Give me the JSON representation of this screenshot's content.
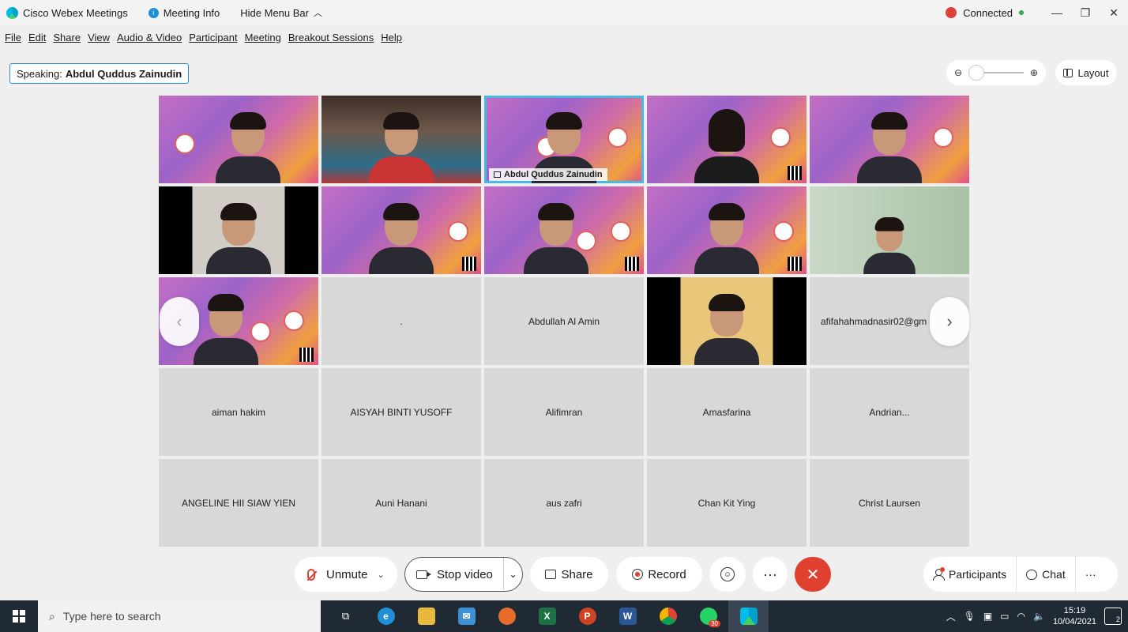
{
  "titlebar": {
    "app_name": "Cisco Webex Meetings",
    "meeting_info": "Meeting Info",
    "hide_menu": "Hide Menu Bar",
    "status": "Connected",
    "min": "—",
    "restore": "❐",
    "close": "✕"
  },
  "menu": [
    "File",
    "Edit",
    "Share",
    "View",
    "Audio & Video",
    "Participant",
    "Meeting",
    "Breakout Sessions",
    "Help"
  ],
  "speaking": {
    "prefix": "Speaking:",
    "name": "Abdul Quddus Zainudin"
  },
  "layout_label": "Layout",
  "active_speaker_label": "Abdul Quddus Zainudin",
  "tiles_row3": {
    "blank": ".",
    "t3": "Abdullah Al Amin",
    "t5": "afifahahmadnasir02@gm"
  },
  "name_tiles": [
    "aiman hakim",
    "AISYAH BINTI YUSOFF",
    "Alifimran",
    "Amasfarina",
    "Andrian...",
    "ANGELINE HII SIAW YIEN",
    "Auni Hanani",
    "aus zafri",
    "Chan Kit Ying",
    "Christ Laursen"
  ],
  "controls": {
    "unmute": "Unmute",
    "stop_video": "Stop video",
    "share": "Share",
    "record": "Record",
    "more": "···",
    "end": "✕",
    "participants": "Participants",
    "chat": "Chat",
    "panel_more": "···"
  },
  "taskbar": {
    "search_placeholder": "Type here to search",
    "time": "15:19",
    "date": "10/04/2021",
    "whatsapp_badge": "30",
    "notifications": "2"
  },
  "colors": {
    "accent": "#2b8cd6",
    "end_call": "#e0402f",
    "active_tile": "#48b8e6",
    "taskbar": "#1f2a35"
  }
}
